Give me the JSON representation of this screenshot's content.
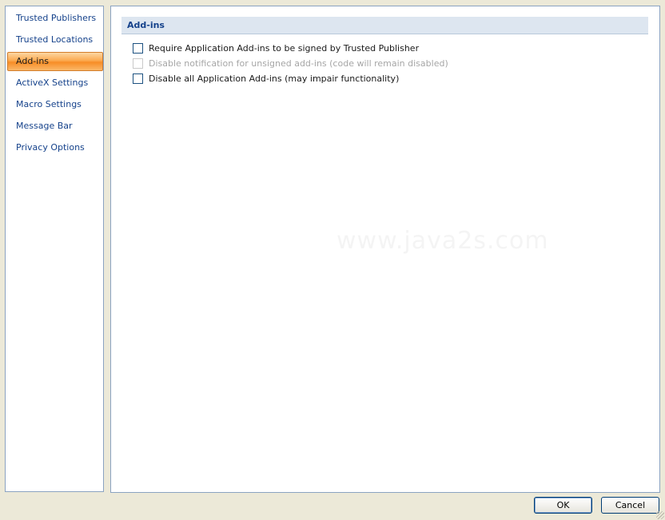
{
  "sidebar": {
    "items": [
      {
        "label": "Trusted Publishers",
        "selected": false
      },
      {
        "label": "Trusted Locations",
        "selected": false
      },
      {
        "label": "Add-ins",
        "selected": true
      },
      {
        "label": "ActiveX Settings",
        "selected": false
      },
      {
        "label": "Macro Settings",
        "selected": false
      },
      {
        "label": "Message Bar",
        "selected": false
      },
      {
        "label": "Privacy Options",
        "selected": false
      }
    ]
  },
  "main": {
    "section_title": "Add-ins",
    "options": [
      {
        "label": "Require Application Add-ins to be signed by Trusted Publisher",
        "checked": false,
        "enabled": true
      },
      {
        "label": "Disable notification for unsigned add-ins (code will remain disabled)",
        "checked": false,
        "enabled": false
      },
      {
        "label": "Disable all Application Add-ins (may impair functionality)",
        "checked": false,
        "enabled": true
      }
    ],
    "watermark": "www.java2s.com"
  },
  "footer": {
    "ok_label": "OK",
    "cancel_label": "Cancel"
  },
  "colors": {
    "accent": "#15428b",
    "selected_item": "#fba94f",
    "header_band": "#dde6f0",
    "dialog_bg": "#ece9d8"
  }
}
